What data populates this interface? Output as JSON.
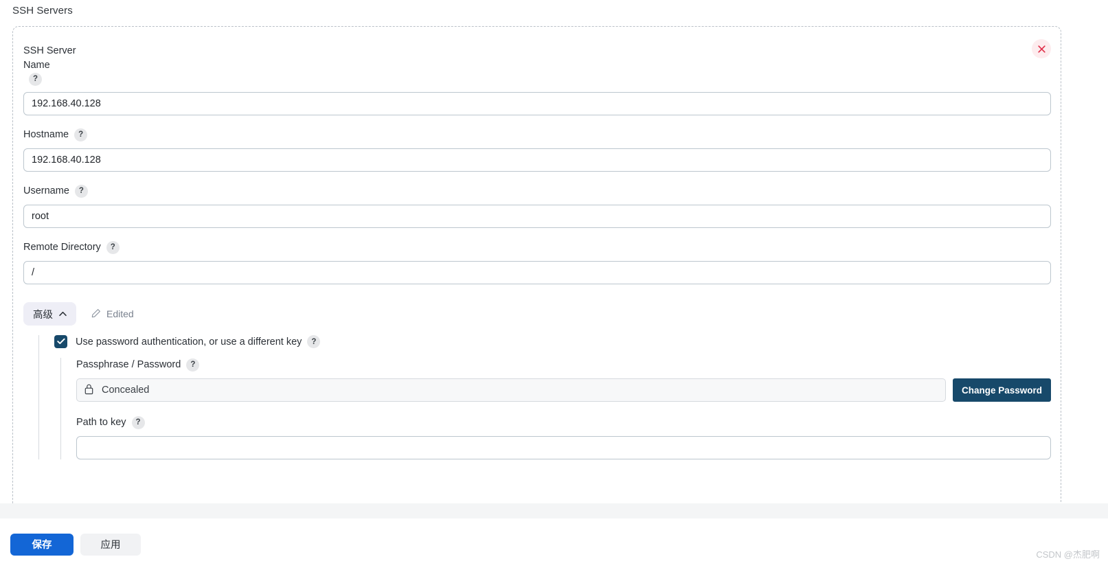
{
  "page": {
    "title": "SSH Servers",
    "watermark": "CSDN @杰肥啊"
  },
  "group": {
    "close_icon": "close-icon",
    "close_label": "×"
  },
  "help_badge_glyph": "?",
  "fields": [
    {
      "label": "SSH Server\nName",
      "help": "?",
      "value": "192.168.40.128",
      "placeholder": "",
      "name": "ssh-server-name"
    },
    {
      "label": "Hostname",
      "help": "?",
      "value": "192.168.40.128",
      "placeholder": "",
      "name": "hostname"
    },
    {
      "label": "Username",
      "help": "?",
      "value": "root",
      "placeholder": "",
      "name": "username"
    },
    {
      "label": "Remote Directory",
      "help": "?",
      "value": "/",
      "placeholder": "",
      "name": "remote-directory"
    }
  ],
  "advanced": {
    "button_label": "高级",
    "chevron_icon": "chevron-up-icon",
    "edited_label": "Edited",
    "edited_icon": "pencil-icon",
    "checkbox": {
      "checked": true,
      "label": "Use password authentication, or use a different key",
      "help": "?"
    },
    "password": {
      "label": "Passphrase / Password",
      "help": "?",
      "lock_icon": "lock-icon",
      "value": "Concealed",
      "change_button": "Change Password"
    },
    "key_path": {
      "label": "Path to key",
      "help": "?",
      "value": "",
      "placeholder": ""
    }
  },
  "footer": {
    "save_label": "保存",
    "apply_label": "应用"
  },
  "colors": {
    "accent_blue": "#1366d6",
    "dark_navy": "#17496a",
    "close_red": "#e0304a",
    "close_bg": "#fdecee",
    "advanced_bg": "#eeeef6",
    "border": "#bcc6ce",
    "dashed_border": "#b9c0c7"
  }
}
